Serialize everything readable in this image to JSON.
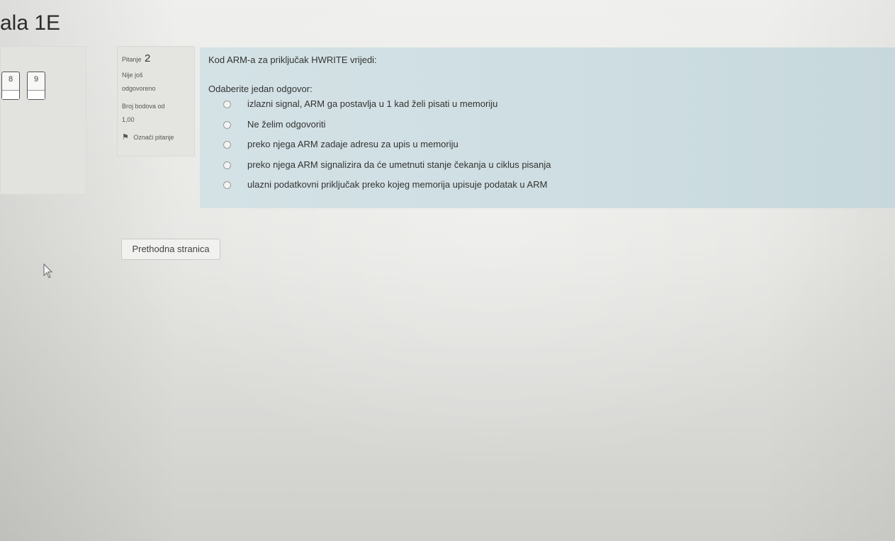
{
  "page": {
    "title": "ala 1E"
  },
  "nav": {
    "buttons": [
      {
        "label": "8"
      },
      {
        "label": "9"
      }
    ]
  },
  "question_info": {
    "label": "Pitanje",
    "number": "2",
    "state_line1": "Nije još",
    "state_line2": "odgovoreno",
    "grade_line1": "Broj bodova od",
    "grade_line2": "1,00",
    "flag_label": "Označi pitanje",
    "flag_icon": "flag-icon"
  },
  "question": {
    "text": "Kod ARM-a za priključak HWRITE vrijedi:",
    "prompt": "Odaberite jedan odgovor:",
    "answers": [
      {
        "label": "izlazni signal, ARM ga postavlja u 1 kad želi pisati u memoriju"
      },
      {
        "label": "Ne želim odgovoriti"
      },
      {
        "label": "preko njega ARM zadaje adresu za upis u memoriju"
      },
      {
        "label": "preko njega ARM signalizira da će umetnuti stanje čekanja u ciklus pisanja"
      },
      {
        "label": "ulazni podatkovni priključak preko kojeg memorija upisuje podatak u ARM"
      }
    ]
  },
  "navigation": {
    "previous_label": "Prethodna stranica"
  },
  "colors": {
    "content_background": "#cddde1",
    "info_background": "#e4e4e1",
    "page_background": "#e6e6e3"
  }
}
